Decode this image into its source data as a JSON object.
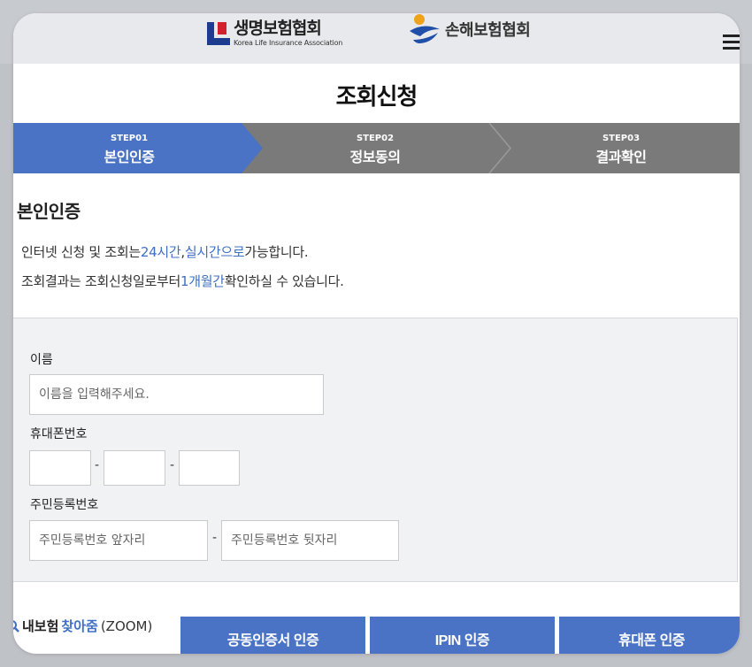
{
  "header": {
    "logo_life": {
      "title": "생명보험협회",
      "subtitle": "Korea Life Insurance Association"
    },
    "logo_nonlife": {
      "title": "손해보험협회"
    },
    "menu_icon": "hamburger-menu-icon"
  },
  "page": {
    "title": "조회신청"
  },
  "steps": [
    {
      "num": "STEP01",
      "label": "본인인증",
      "active": true
    },
    {
      "num": "STEP02",
      "label": "정보동의",
      "active": false
    },
    {
      "num": "STEP03",
      "label": "결과확인",
      "active": false
    }
  ],
  "section": {
    "title": "본인인증"
  },
  "notes": {
    "line1": {
      "pre": "인터넷 신청 및 조회는 ",
      "hl1": "24시간",
      "mid": ", ",
      "hl2": "실시간으로",
      "post": " 가능합니다."
    },
    "line2": {
      "pre": "조회결과는 조회신청일로부터 ",
      "hl": "1개월간",
      "post": " 확인하실 수 있습니다."
    }
  },
  "form": {
    "name_label": "이름",
    "name_placeholder": "이름을 입력해주세요.",
    "phone_label": "휴대폰번호",
    "phone_sep": "-",
    "rrn_label": "주민등록번호",
    "rrn_front_placeholder": "주민등록번호 앞자리",
    "rrn_back_placeholder": "주민등록번호 뒷자리",
    "rrn_sep": "-"
  },
  "footer": {
    "find_a": "내보험",
    "find_b": "찾아줌",
    "find_c": "(ZOOM)",
    "buttons": {
      "cert": "공동인증서 인증",
      "ipin": "IPIN 인증",
      "phone": "휴대폰 인증"
    }
  },
  "colors": {
    "accent": "#4a73c5",
    "step_inactive": "#7a7a7a",
    "highlight": "#3f6fc5"
  }
}
